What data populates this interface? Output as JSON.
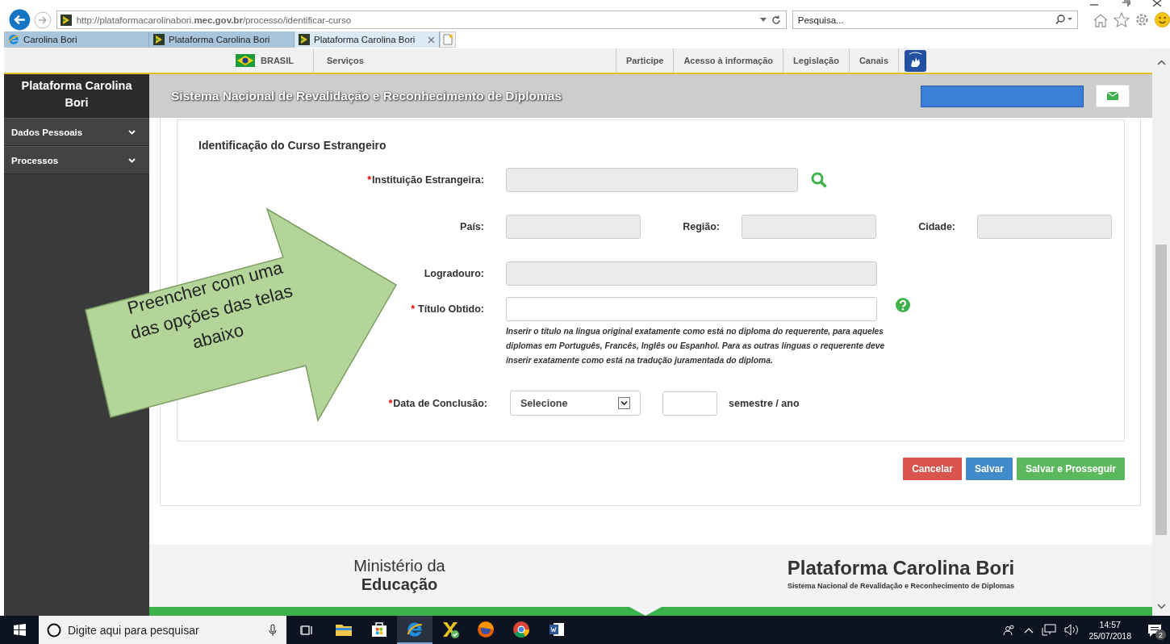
{
  "browser": {
    "url": "http://plataformacarolinabori.**mec.gov.br**/processo/identificar-curso",
    "search_placeholder": "Pesquisa...",
    "tabs": [
      {
        "label": "Carolina Bori",
        "selected": false,
        "kind": "ie"
      },
      {
        "label": "Plataforma Carolina Bori",
        "selected": false,
        "kind": "site"
      },
      {
        "label": "Plataforma Carolina Bori",
        "selected": true,
        "kind": "site"
      }
    ]
  },
  "gov_bar": {
    "country": "BRASIL",
    "services": "Serviços",
    "links": [
      "Participe",
      "Acesso à informação",
      "Legislação",
      "Canais"
    ]
  },
  "sidebar": {
    "title": "Plataforma Carolina Bori",
    "items": [
      {
        "label": "Dados Pessoais",
        "expanded": false
      },
      {
        "label": "Processos",
        "expanded": false
      }
    ]
  },
  "header": {
    "title": "Sistema Nacional de Revalidação e Reconhecimento de Diplomas"
  },
  "form": {
    "title": "Identificação do Curso Estrangeiro",
    "rows": [
      {
        "kind": "search",
        "fields": [
          {
            "mark": "*",
            "label": "Instituição Estrangeira:",
            "disabled": true
          }
        ]
      },
      {
        "kind": "location",
        "fields": [
          {
            "label": "País:",
            "disabled": true
          },
          {
            "label": "Região:",
            "disabled": true
          },
          {
            "label": "Cidade:",
            "disabled": true
          }
        ]
      },
      {
        "kind": "plain",
        "fields": [
          {
            "label": "Logradouro:",
            "disabled": true
          }
        ]
      },
      {
        "kind": "hinted",
        "fields": [
          {
            "mark": "*",
            "label": "Título Obtido:",
            "disabled": false
          }
        ],
        "hint": "Inserir o título na língua original exatamente como está no diploma do requerente, para aqueles diplomas em Português, Francês, Inglês ou Espanhol. Para as outras línguas o requerente deve inserir exatamente como está na tradução juramentada do diploma."
      },
      {
        "kind": "date",
        "fields": [
          {
            "mark": "*",
            "label": "Data de Conclusão:",
            "disabled": false
          }
        ],
        "select": "Selecione",
        "unit": "semestre / ano"
      }
    ]
  },
  "buttons": [
    {
      "label": "Cancelar",
      "kind": "danger"
    },
    {
      "label": "Salvar",
      "kind": "primary"
    },
    {
      "label": "Salvar e Prosseguir",
      "kind": "success"
    }
  ],
  "footer": {
    "ministry_top": "Ministério da",
    "ministry_bottom": "Educação",
    "brand": "Plataforma Carolina Bori",
    "brand_sub": "Sistema Nacional de Revalidação e Reconhecimento de Diplomas"
  },
  "callout": {
    "text": "Preencher com uma das opções das telas abaixo"
  },
  "taskbar": {
    "search_placeholder": "Digite aqui para pesquisar",
    "apps": [
      {
        "kind": "explorer",
        "active": false
      },
      {
        "kind": "store",
        "active": false
      },
      {
        "kind": "ie",
        "active": true
      },
      {
        "kind": "xapp",
        "active": false
      },
      {
        "kind": "firefox",
        "active": false
      },
      {
        "kind": "chrome",
        "active": false
      },
      {
        "kind": "word",
        "active": false
      }
    ],
    "time": "14:57",
    "date": "25/07/2018",
    "notifications": "2"
  }
}
